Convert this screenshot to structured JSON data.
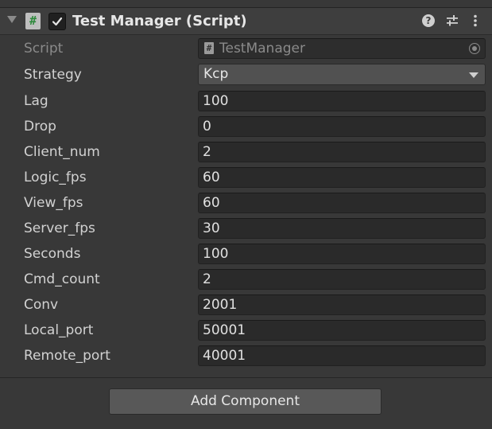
{
  "component": {
    "title": "Test Manager (Script)",
    "script_icon_glyph": "#",
    "help_glyph": "?",
    "enabled": true,
    "icons": [
      "foldout-arrow-icon",
      "script-icon",
      "checkbox-icon",
      "help-icon",
      "presets-icon",
      "kebab-menu-icon"
    ]
  },
  "script_field": {
    "label": "Script",
    "value": "TestManager",
    "icon_glyph": "#"
  },
  "strategy": {
    "label": "Strategy",
    "value": "Kcp"
  },
  "fields": [
    {
      "label": "Lag",
      "value": "100"
    },
    {
      "label": "Drop",
      "value": "0"
    },
    {
      "label": "Client_num",
      "value": "2"
    },
    {
      "label": "Logic_fps",
      "value": "60"
    },
    {
      "label": "View_fps",
      "value": "60"
    },
    {
      "label": "Server_fps",
      "value": "30"
    },
    {
      "label": "Seconds",
      "value": "100"
    },
    {
      "label": "Cmd_count",
      "value": "2"
    },
    {
      "label": "Conv",
      "value": "2001"
    },
    {
      "label": "Local_port",
      "value": "50001"
    },
    {
      "label": "Remote_port",
      "value": "40001"
    }
  ],
  "add_component_label": "Add Component"
}
